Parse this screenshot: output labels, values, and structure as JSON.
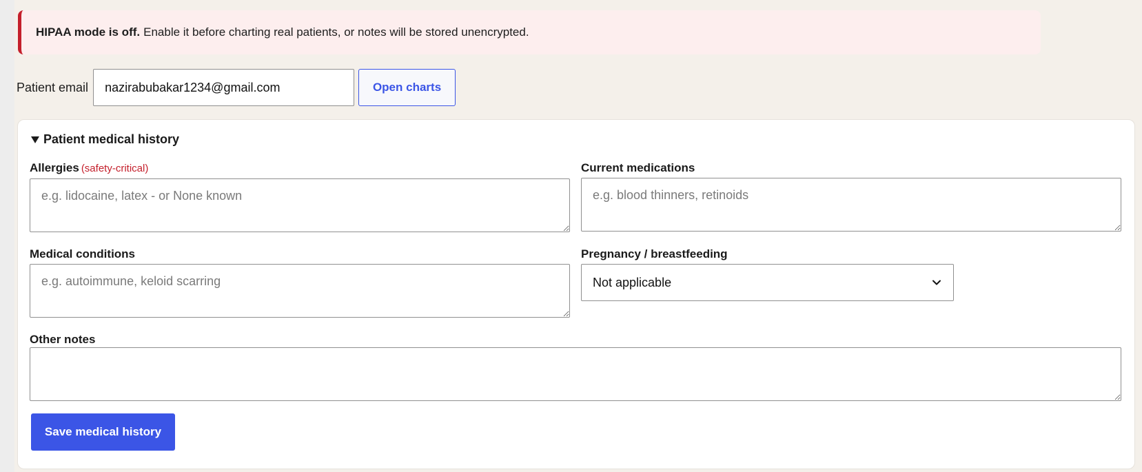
{
  "alert": {
    "bold": "HIPAA mode is off.",
    "text": "Enable it before charting real patients, or notes will be stored unencrypted."
  },
  "email": {
    "label": "Patient email",
    "value": "nazirabubakar1234@gmail.com",
    "button": "Open charts"
  },
  "history": {
    "summary": "Patient medical history",
    "allergies": {
      "label": "Allergies",
      "note": "(safety-critical)",
      "placeholder": "e.g. lidocaine, latex - or None known"
    },
    "medications": {
      "label": "Current medications",
      "placeholder": "e.g. blood thinners, retinoids"
    },
    "conditions": {
      "label": "Medical conditions",
      "placeholder": "e.g. autoimmune, keloid scarring"
    },
    "pregnancy": {
      "label": "Pregnancy / breastfeeding",
      "selected": "Not applicable"
    },
    "other": {
      "label": "Other notes",
      "placeholder": ""
    },
    "save_button": "Save medical history"
  },
  "colors": {
    "accent": "#3b55e6",
    "danger": "#c41f2b",
    "alert_bg": "#fdeeee"
  }
}
